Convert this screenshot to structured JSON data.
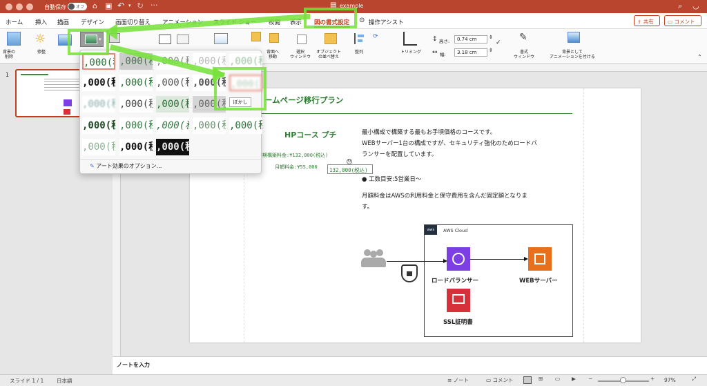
{
  "titlebar": {
    "autosave_label": "自動保存",
    "autosave_state": "オフ",
    "document_title": "example"
  },
  "tabs": [
    "ホーム",
    "挿入",
    "描画",
    "デザイン",
    "画面切り替え",
    "アニメーション",
    "スライド ショー",
    "校閲",
    "表示",
    "図の書式設定",
    "操作アシスト"
  ],
  "share": {
    "share_label": "共有",
    "comment_label": "コメント"
  },
  "ribbon": {
    "remove_bg": "背景の\n削除",
    "corrections": "修整",
    "bring_forward": "背面へ\n移動",
    "selection_pane": "選択\nウィンドウ",
    "arrange": "オブジェクト\nの並べ替え",
    "align": "整列",
    "crop": "トリミング",
    "height_label": "高さ:",
    "height_value": "0.74 cm",
    "width_label": "幅:",
    "width_value": "3.18 cm",
    "format_pane": "書式\nウィンドウ",
    "animate_as_bg": "背景として\nアニメーションを付ける"
  },
  "gallery": {
    "cells": [
      [
        ",000(税",
        ",000(税",
        ",000(税",
        ",000(税",
        ",000(税"
      ],
      [
        ",000(税",
        ",000(税",
        ",000(税",
        ",000(税",
        ",000(税"
      ],
      [
        ",000(税",
        ",000(税",
        ",000(税",
        ",000(税",
        ""
      ],
      [
        ",000(税",
        ",000(税",
        ",000(税",
        ",000(税",
        ",000(税"
      ],
      [
        ",000(税",
        ",000(税",
        ",000(税"
      ]
    ],
    "tooltip": "ぼかし",
    "options_label": "アート効果のオプション..."
  },
  "thumbnail": {
    "number": "1"
  },
  "slide": {
    "title": "ームページ移行プラン",
    "course": "HPコース プチ",
    "initial_fee": "初期構築料金:¥132,000(税込)",
    "monthly_fee": "月額料金:¥55,000",
    "selected_text": "132,000(税込)",
    "desc1": "最小構成で構築する最もお手頃価格のコースです。",
    "desc2": "WEBサーバー1台の構成ですが、セキュリティ強化のためロードバ",
    "desc3": "ランサーを配置しています。",
    "bullet": "工数目安:5営業日〜",
    "monthly_desc1": "月額料金はAWSの利用料金と保守費用を含んだ固定額となりま",
    "monthly_desc2": "す。",
    "aws_cloud": "AWS Cloud",
    "aws_badge": "aws",
    "lb_label": "ロードバランサー",
    "web_label": "WEBサーバー",
    "ssl_label": "SSL証明書"
  },
  "notes": {
    "placeholder": "ノートを入力"
  },
  "status": {
    "slide": "スライド 1 / 1",
    "language": "日本語",
    "notes": "ノート",
    "comments": "コメント",
    "zoom": "97%"
  },
  "colors": {
    "titlebar": "#b9452f",
    "accent": "#c43e1c",
    "green_text": "#2e7d32",
    "highlight": "#78e13c",
    "aws_orange": "#e8701a",
    "aws_purple": "#7b3fe4",
    "aws_red": "#d6313b"
  }
}
